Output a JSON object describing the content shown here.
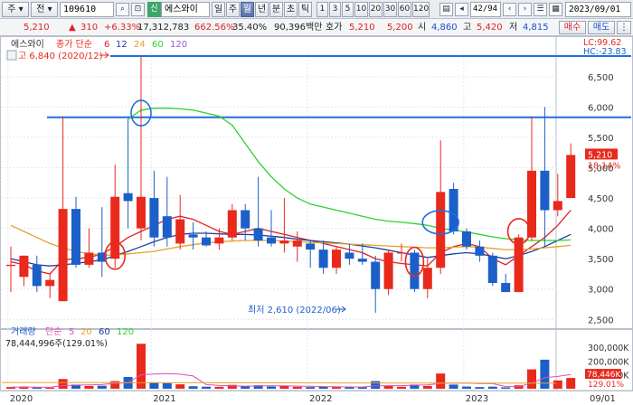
{
  "toolbar": {
    "market_select": "주",
    "period_select": "전",
    "code": "109610",
    "credit_badge": "신",
    "name": "에스와이",
    "period_tabs": [
      "일",
      "주",
      "월",
      "년",
      "분",
      "초",
      "틱"
    ],
    "active_period": "월",
    "intervals": [
      "1",
      "3",
      "5",
      "10",
      "20",
      "30",
      "60",
      "120"
    ],
    "page_counter": "42/94",
    "date": "2023/09/01",
    "buy_button": "매수",
    "sell_button": "매도"
  },
  "quote": {
    "price": "5,210",
    "change_arrow": "▲",
    "change": "310",
    "change_pct": "+6.33%",
    "volume": "17,312,783",
    "volume_ratio": "662.56%",
    "turnover": "35.40%",
    "amount": "90,396백만",
    "ask_label": "호가",
    "ask": "5,210",
    "bid": "5,200",
    "open_label": "시",
    "open": "4,860",
    "high_label": "고",
    "high": "5,420",
    "low_label": "저",
    "low": "4,815"
  },
  "price_panel": {
    "legend_name": "에스와이",
    "legend_ma_label": "종가 단순",
    "ma_periods": [
      "6",
      "12",
      "24",
      "60",
      "120"
    ],
    "ma_colors": [
      "#e02020",
      "#1f3fa0",
      "#e6a22a",
      "#2ed12e",
      "#9b59d0"
    ],
    "high_note": "고 6,840 (2020/12)",
    "low_note": "최저 2,610 (2022/06)",
    "lc_label": "LC:99.62",
    "hc_label": "HC:-23.83",
    "current_price_tag": "5,210",
    "current_pct_tag": "18.14%",
    "y_ticks": [
      "6,500",
      "6,000",
      "5,500",
      "5,000",
      "4,500",
      "4,000",
      "3,500",
      "3,000",
      "2,500"
    ]
  },
  "volume_panel": {
    "legend_name": "거래량",
    "legend_ma_label": "단순",
    "ma_periods": [
      "5",
      "20",
      "60",
      "120"
    ],
    "ma_colors": [
      "#e14fb5",
      "#e6a22a",
      "#1f3fa0",
      "#2ed12e"
    ],
    "current_volume": "78,444,996주(129.01%)",
    "y_ticks": [
      "300,000K",
      "200,000K",
      "100,000K"
    ],
    "current_volume_tag": "78,446K",
    "current_pct_tag": "129.01%"
  },
  "x_axis": [
    "2020",
    "2021",
    "2022",
    "2023",
    "09/01"
  ],
  "chart_data": {
    "type": "candlestick",
    "title": "에스와이 (109610) 월봉",
    "ylim": [
      2400,
      6900
    ],
    "candles": [
      {
        "date": "2020/02",
        "open": 3380,
        "high": 3700,
        "low": 2950,
        "close": 3400
      },
      {
        "date": "2020/03",
        "open": 3200,
        "high": 3550,
        "low": 3050,
        "close": 3550
      },
      {
        "date": "2020/04",
        "open": 3400,
        "high": 3550,
        "low": 2950,
        "close": 3050
      },
      {
        "date": "2020/05",
        "open": 3050,
        "high": 3250,
        "low": 2850,
        "close": 3150
      },
      {
        "date": "2020/06",
        "open": 2800,
        "high": 5850,
        "low": 2800,
        "close": 4320
      },
      {
        "date": "2020/07",
        "open": 4320,
        "high": 4520,
        "low": 3350,
        "close": 3400
      },
      {
        "date": "2020/08",
        "open": 3400,
        "high": 4000,
        "low": 3350,
        "close": 3600
      },
      {
        "date": "2020/09",
        "open": 3600,
        "high": 4350,
        "low": 3200,
        "close": 3450
      },
      {
        "date": "2020/10",
        "open": 3500,
        "high": 5050,
        "low": 3350,
        "close": 4520
      },
      {
        "date": "2020/11",
        "open": 4580,
        "high": 5800,
        "low": 4000,
        "close": 4450
      },
      {
        "date": "2020/12",
        "open": 4000,
        "high": 6840,
        "low": 3800,
        "close": 4520
      },
      {
        "date": "2021/01",
        "open": 4500,
        "high": 4950,
        "low": 3700,
        "close": 3850
      },
      {
        "date": "2021/02",
        "open": 4200,
        "high": 4850,
        "low": 3700,
        "close": 3850
      },
      {
        "date": "2021/03",
        "open": 3750,
        "high": 4550,
        "low": 3650,
        "close": 4150
      },
      {
        "date": "2021/04",
        "open": 3900,
        "high": 4100,
        "low": 3650,
        "close": 3850
      },
      {
        "date": "2021/05",
        "open": 3850,
        "high": 3950,
        "low": 3700,
        "close": 3720
      },
      {
        "date": "2021/06",
        "open": 3750,
        "high": 4000,
        "low": 3650,
        "close": 3850
      },
      {
        "date": "2021/07",
        "open": 3850,
        "high": 4400,
        "low": 3800,
        "close": 4300
      },
      {
        "date": "2021/08",
        "open": 4300,
        "high": 4400,
        "low": 3800,
        "close": 4000
      },
      {
        "date": "2021/09",
        "open": 4000,
        "high": 4850,
        "low": 3700,
        "close": 3800
      },
      {
        "date": "2021/10",
        "open": 3850,
        "high": 4300,
        "low": 3700,
        "close": 3750
      },
      {
        "date": "2021/11",
        "open": 3750,
        "high": 4500,
        "low": 3600,
        "close": 3800
      },
      {
        "date": "2021/12",
        "open": 3700,
        "high": 3950,
        "low": 3450,
        "close": 3800
      },
      {
        "date": "2022/01",
        "open": 3750,
        "high": 3800,
        "low": 3350,
        "close": 3650
      },
      {
        "date": "2022/02",
        "open": 3650,
        "high": 3800,
        "low": 3250,
        "close": 3350
      },
      {
        "date": "2022/03",
        "open": 3350,
        "high": 3700,
        "low": 3250,
        "close": 3650
      },
      {
        "date": "2022/04",
        "open": 3600,
        "high": 3750,
        "low": 3400,
        "close": 3500
      },
      {
        "date": "2022/05",
        "open": 3500,
        "high": 3750,
        "low": 3400,
        "close": 3450
      },
      {
        "date": "2022/06",
        "open": 3450,
        "high": 3550,
        "low": 2610,
        "close": 3000
      },
      {
        "date": "2022/07",
        "open": 3000,
        "high": 3650,
        "low": 2900,
        "close": 3600
      },
      {
        "date": "2022/08",
        "open": 3600,
        "high": 3750,
        "low": 3450,
        "close": 3600
      },
      {
        "date": "2022/09",
        "open": 3600,
        "high": 3650,
        "low": 2950,
        "close": 3000
      },
      {
        "date": "2022/10",
        "open": 3000,
        "high": 3500,
        "low": 2850,
        "close": 3350
      },
      {
        "date": "2022/11",
        "open": 3350,
        "high": 5450,
        "low": 3250,
        "close": 4600
      },
      {
        "date": "2022/12",
        "open": 4650,
        "high": 4750,
        "low": 3900,
        "close": 3950
      },
      {
        "date": "2023/01",
        "open": 3950,
        "high": 4000,
        "low": 3650,
        "close": 3700
      },
      {
        "date": "2023/02",
        "open": 3700,
        "high": 3800,
        "low": 3450,
        "close": 3550
      },
      {
        "date": "2023/03",
        "open": 3550,
        "high": 3600,
        "low": 3050,
        "close": 3100
      },
      {
        "date": "2023/04",
        "open": 3100,
        "high": 3250,
        "low": 2950,
        "close": 2950
      },
      {
        "date": "2023/05",
        "open": 2950,
        "high": 3900,
        "low": 2950,
        "close": 3850
      },
      {
        "date": "2023/06",
        "open": 3850,
        "high": 5850,
        "low": 3800,
        "close": 4950
      },
      {
        "date": "2023/07",
        "open": 4950,
        "high": 6000,
        "low": 3700,
        "close": 4300
      },
      {
        "date": "2023/08",
        "open": 4300,
        "high": 4900,
        "low": 4200,
        "close": 4450
      },
      {
        "date": "2023/09",
        "open": 4500,
        "high": 5400,
        "low": 4500,
        "close": 5210
      }
    ],
    "ma": {
      "ma6": [
        3450,
        3400,
        3300,
        3250,
        3480,
        3500,
        3520,
        3580,
        3700,
        3850,
        3950,
        4050,
        4150,
        4200,
        4150,
        4050,
        3950,
        3900,
        3950,
        4000,
        3950,
        3900,
        3850,
        3800,
        3750,
        3700,
        3650,
        3600,
        3500,
        3450,
        3420,
        3400,
        3380,
        3600,
        3700,
        3750,
        3700,
        3500,
        3400,
        3550,
        3700,
        3850,
        4050,
        4300
      ],
      "ma12": [
        3500,
        3450,
        3400,
        3380,
        3400,
        3420,
        3450,
        3480,
        3550,
        3620,
        3700,
        3780,
        3850,
        3900,
        3920,
        3920,
        3910,
        3900,
        3900,
        3890,
        3870,
        3850,
        3820,
        3800,
        3780,
        3760,
        3740,
        3710,
        3680,
        3640,
        3600,
        3560,
        3520,
        3550,
        3580,
        3600,
        3580,
        3540,
        3500,
        3550,
        3620,
        3700,
        3800,
        3900
      ],
      "ma24": [
        4050,
        3950,
        3850,
        3750,
        3680,
        3620,
        3580,
        3560,
        3560,
        3580,
        3600,
        3620,
        3660,
        3700,
        3730,
        3760,
        3780,
        3790,
        3800,
        3800,
        3800,
        3790,
        3780,
        3770,
        3760,
        3750,
        3740,
        3730,
        3720,
        3710,
        3700,
        3690,
        3680,
        3680,
        3690,
        3700,
        3690,
        3670,
        3650,
        3650,
        3660,
        3680,
        3700,
        3720
      ],
      "ma60": [
        null,
        null,
        null,
        null,
        null,
        null,
        null,
        null,
        null,
        5800,
        5950,
        5980,
        5980,
        5970,
        5950,
        5900,
        5850,
        5700,
        5400,
        5100,
        4850,
        4650,
        4500,
        4400,
        4350,
        4300,
        4250,
        4200,
        4150,
        4120,
        4100,
        4080,
        4050,
        4000,
        3970,
        3940,
        3900,
        3860,
        3830,
        3810,
        3800,
        3800,
        3800,
        3810
      ]
    }
  }
}
